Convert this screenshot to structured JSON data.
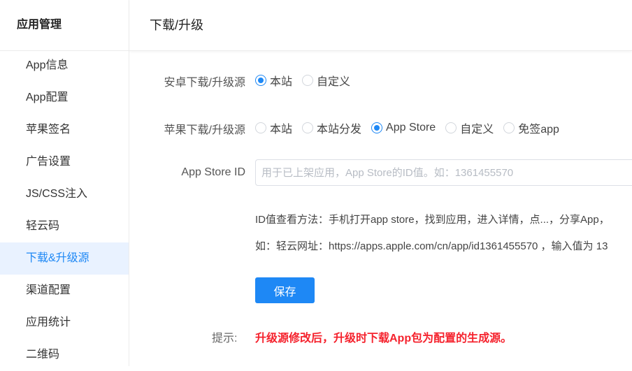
{
  "sidebar": {
    "title": "应用管理",
    "items": [
      {
        "label": "App信息"
      },
      {
        "label": "App配置"
      },
      {
        "label": "苹果签名"
      },
      {
        "label": "广告设置"
      },
      {
        "label": "JS/CSS注入"
      },
      {
        "label": "轻云码"
      },
      {
        "label": "下载&升级源",
        "active": true
      },
      {
        "label": "渠道配置"
      },
      {
        "label": "应用统计"
      },
      {
        "label": "二维码"
      }
    ]
  },
  "page": {
    "title": "下载/升级"
  },
  "form": {
    "android": {
      "label": "安卓下载/升级源",
      "options": [
        "本站",
        "自定义"
      ],
      "selected": "本站"
    },
    "apple": {
      "label": "苹果下载/升级源",
      "options": [
        "本站",
        "本站分发",
        "App Store",
        "自定义",
        "免签app"
      ],
      "selected": "App Store"
    },
    "appstore_id": {
      "label": "App Store ID",
      "value": "",
      "placeholder": "用于已上架应用，App Store的ID值。如：1361455570"
    },
    "help_line1": "ID值查看方法：手机打开app store，找到应用，进入详情，点...，分享App，",
    "help_line2": "如：轻云网址：https://apps.apple.com/cn/app/id1361455570 ，输入值为 13",
    "save_label": "保存",
    "tip_label": "提示:",
    "tip_text": "升级源修改后，升级时下载App包为配置的生成源。"
  },
  "colors": {
    "accent": "#1e88f5",
    "active_bg": "#e9f2ff",
    "warning": "#f5222d"
  }
}
